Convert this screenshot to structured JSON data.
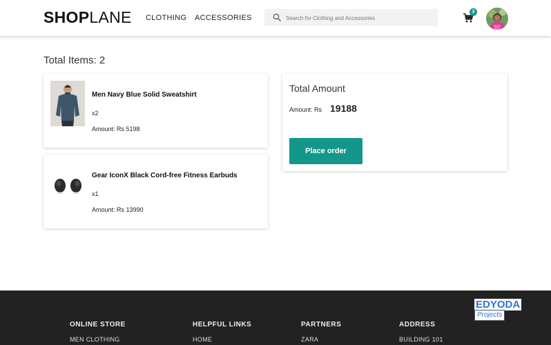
{
  "header": {
    "logo_bold": "SHOP",
    "logo_light": "LANE",
    "nav": [
      "CLOTHING",
      "ACCESSORIES"
    ],
    "search_placeholder": "Search for Clothing and Accessories",
    "cart_count": "3"
  },
  "cart": {
    "total_items_label": "Total Items: 2",
    "items": [
      {
        "name": "Men Navy Blue Solid Sweatshirt",
        "qty": "x2",
        "amount": "Amount: Rs 5198",
        "icon": "sweatshirt-image"
      },
      {
        "name": "Gear IconX Black Cord-free Fitness Earbuds",
        "qty": "x1",
        "amount": "Amount: Rs 13990",
        "icon": "earbuds-image"
      }
    ]
  },
  "summary": {
    "title": "Total Amount",
    "amount_label": "Amount: Rs",
    "amount_value": "19188",
    "button": "Place order"
  },
  "footer": {
    "columns": [
      {
        "heading": "ONLINE STORE",
        "first_link": "MEN CLOTHING"
      },
      {
        "heading": "HELPFUL LINKS",
        "first_link": "HOME"
      },
      {
        "heading": "PARTNERS",
        "first_link": "ZARA"
      },
      {
        "heading": "ADDRESS",
        "first_link": "BUILDING 101"
      }
    ],
    "brand_top": "EDYODA",
    "brand_bottom": "Projects"
  },
  "colors": {
    "accent": "#13978a",
    "footer_bg": "#222222",
    "brand_blue": "#2b74d6"
  }
}
